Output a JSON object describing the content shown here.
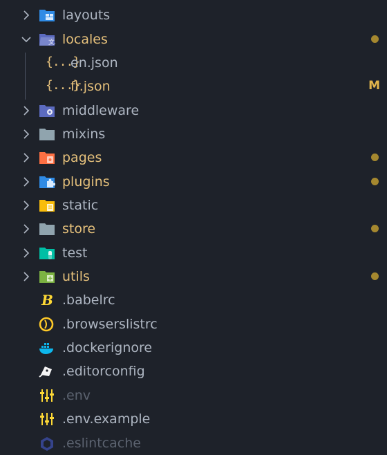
{
  "explorer": {
    "items": [
      {
        "label": "layouts",
        "kind": "folder",
        "expanded": false,
        "status": "normal",
        "icon": "layouts-folder-icon"
      },
      {
        "label": "locales",
        "kind": "folder",
        "expanded": true,
        "status": "modified",
        "icon": "locales-folder-icon"
      },
      {
        "label": "en.json",
        "kind": "file",
        "status": "normal",
        "icon": "json-file-icon"
      },
      {
        "label": "fr.json",
        "kind": "file",
        "status": "modified",
        "badge": "M",
        "icon": "json-file-icon"
      },
      {
        "label": "middleware",
        "kind": "folder",
        "expanded": false,
        "status": "normal",
        "icon": "middleware-folder-icon"
      },
      {
        "label": "mixins",
        "kind": "folder",
        "expanded": false,
        "status": "normal",
        "icon": "folder-icon"
      },
      {
        "label": "pages",
        "kind": "folder",
        "expanded": false,
        "status": "modified",
        "icon": "pages-folder-icon"
      },
      {
        "label": "plugins",
        "kind": "folder",
        "expanded": false,
        "status": "modified",
        "icon": "plugins-folder-icon"
      },
      {
        "label": "static",
        "kind": "folder",
        "expanded": false,
        "status": "normal",
        "icon": "static-folder-icon"
      },
      {
        "label": "store",
        "kind": "folder",
        "expanded": false,
        "status": "modified",
        "icon": "folder-icon"
      },
      {
        "label": "test",
        "kind": "folder",
        "expanded": false,
        "status": "normal",
        "icon": "test-folder-icon"
      },
      {
        "label": "utils",
        "kind": "folder",
        "expanded": false,
        "status": "modified",
        "icon": "utils-folder-icon"
      },
      {
        "label": ".babelrc",
        "kind": "file",
        "status": "normal",
        "icon": "babel-icon"
      },
      {
        "label": ".browserslistrc",
        "kind": "file",
        "status": "normal",
        "icon": "browserslist-icon"
      },
      {
        "label": ".dockerignore",
        "kind": "file",
        "status": "normal",
        "icon": "docker-icon"
      },
      {
        "label": ".editorconfig",
        "kind": "file",
        "status": "normal",
        "icon": "editorconfig-icon"
      },
      {
        "label": ".env",
        "kind": "file",
        "status": "ignored",
        "icon": "env-icon"
      },
      {
        "label": ".env.example",
        "kind": "file",
        "status": "normal",
        "icon": "env-icon"
      },
      {
        "label": ".eslintcache",
        "kind": "file",
        "status": "ignored",
        "icon": "eslint-icon"
      }
    ],
    "json_icon_text": "{...}",
    "colors": {
      "background": "#1e222a",
      "modified": "#e5c07b",
      "normal": "#aeb6c2",
      "ignored": "#5c6370",
      "dot": "#a5882f"
    }
  }
}
